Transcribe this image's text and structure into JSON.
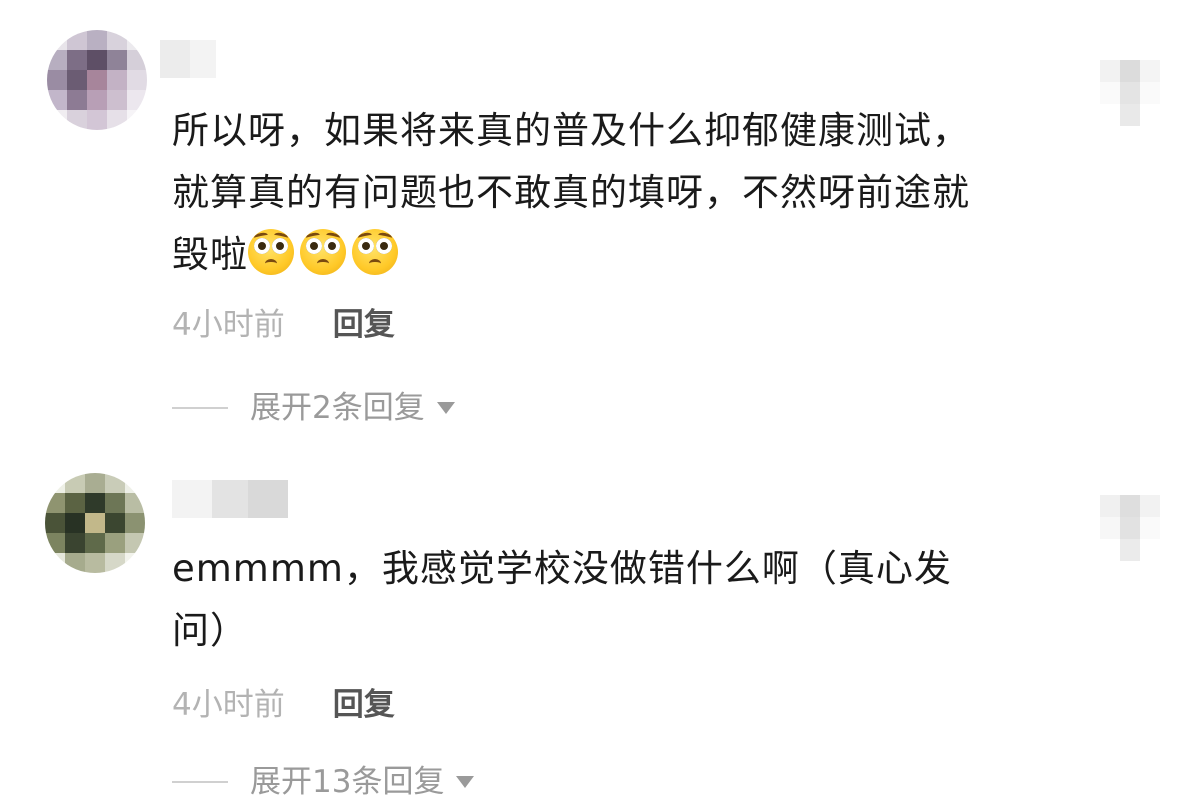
{
  "comments": [
    {
      "lines": [
        "所以呀，如果将来真的普及什么抑郁健康测试，",
        "就算真的有问题也不敢真的填呀，不然呀前途就",
        "毁啦"
      ],
      "emojis": [
        "pleading-face-icon",
        "pleading-face-icon",
        "pleading-face-icon"
      ],
      "time": "4小时前",
      "reply_label": "回复",
      "expand_label": "展开2条回复"
    },
    {
      "lines": [
        "emmmm，我感觉学校没做错什么啊（真心发",
        "问）"
      ],
      "time": "4小时前",
      "reply_label": "回复",
      "expand_label": "展开13条回复"
    }
  ],
  "colors": {
    "text": "#1a1a1a",
    "meta": "#b3b3b3",
    "reply": "#555555",
    "expand": "#9a9a9a",
    "emoji": "#ffc928"
  }
}
